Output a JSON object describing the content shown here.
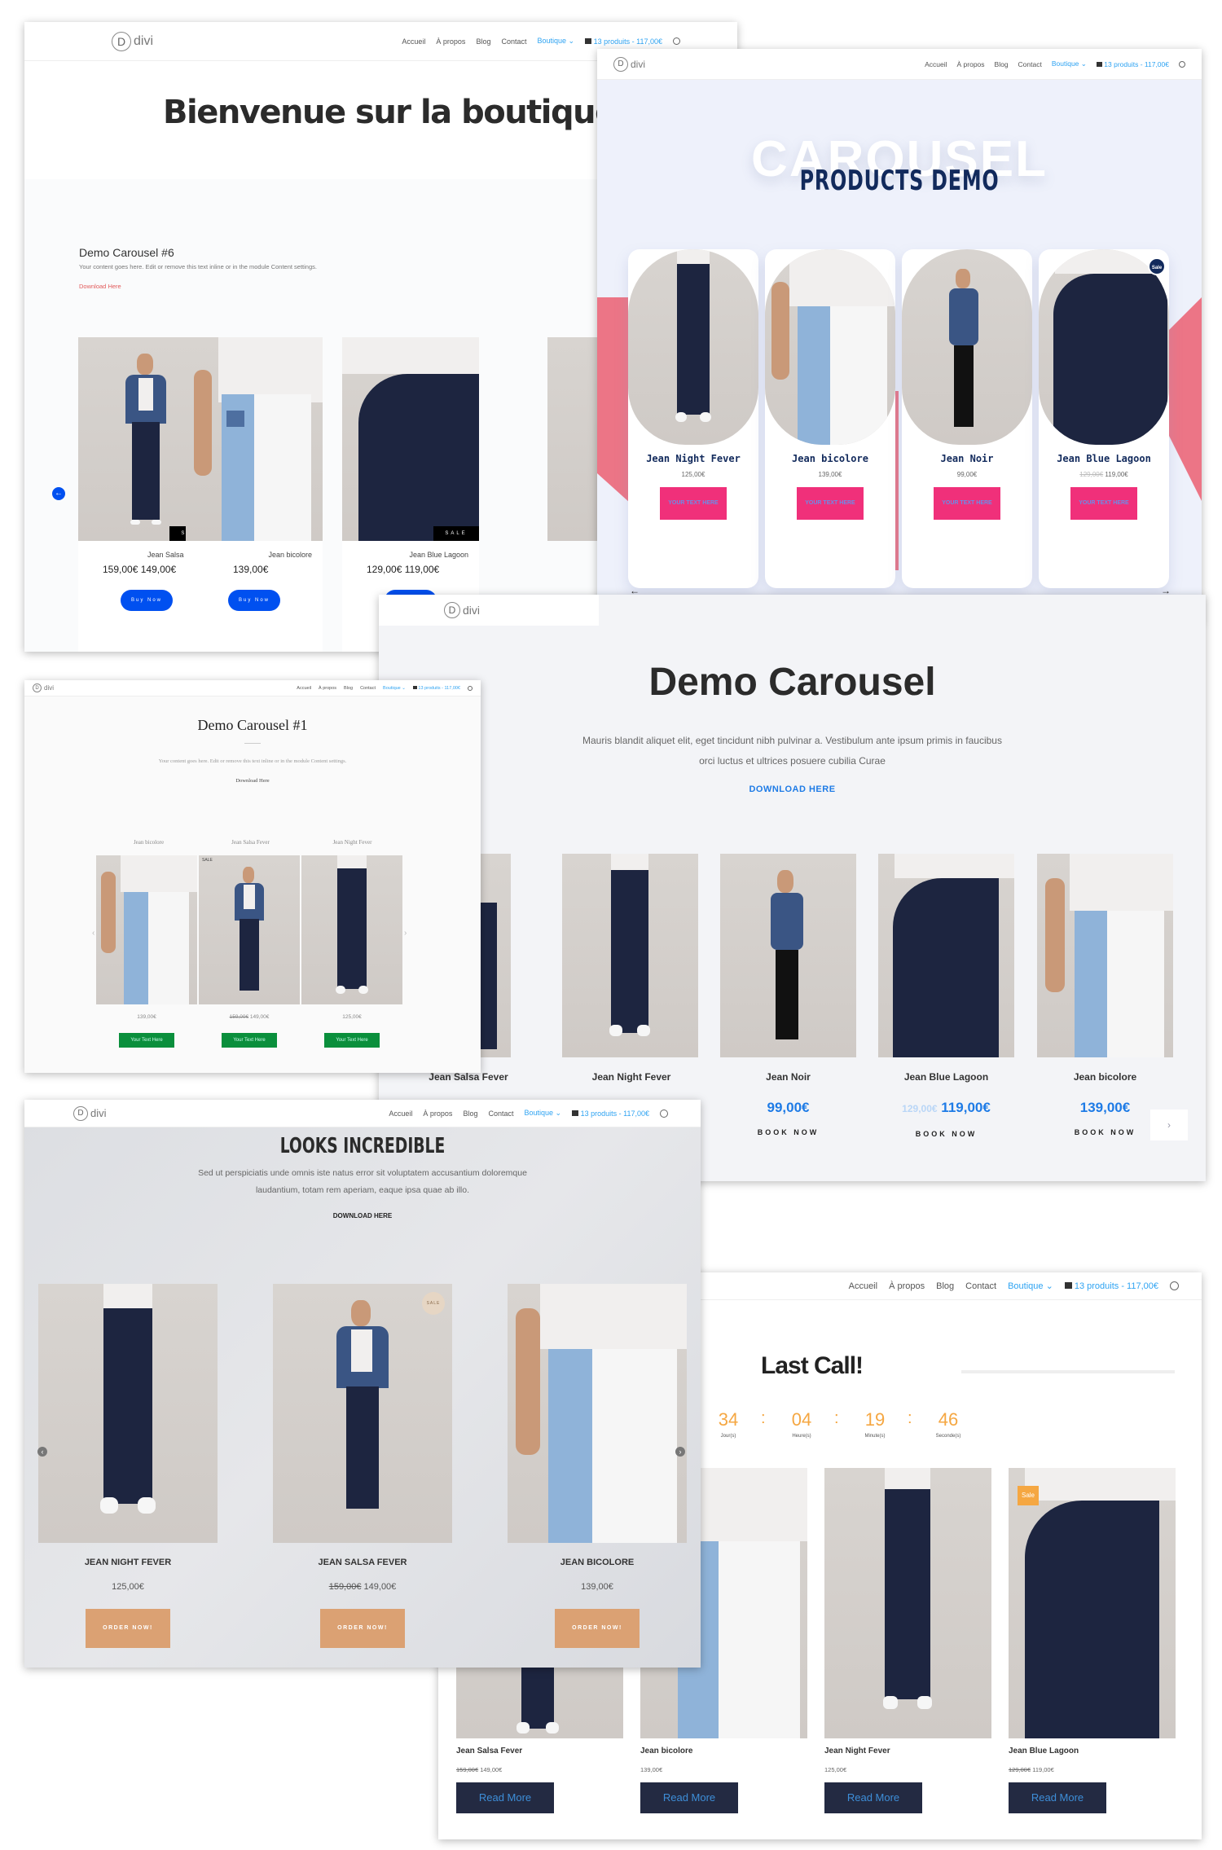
{
  "nav": {
    "logo": "divi",
    "logo_letter": "D",
    "items": [
      "Accueil",
      "À propos",
      "Blog",
      "Contact"
    ],
    "shop": "Boutique",
    "cart": "13 produits - 117,00€"
  },
  "panel1": {
    "title": "Bienvenue sur la boutique !",
    "module_title": "Demo Carousel #6",
    "module_text": "Your content goes here. Edit or remove this text inline or in the module Content settings.",
    "module_link": "Download Here",
    "sale_label": "SALE",
    "products": [
      {
        "name": "Jean Salsa Fever",
        "old_price": "159,00€",
        "price": "149,00€",
        "button": "Buy Now",
        "sale": true
      },
      {
        "name": "Jean bicolore",
        "old_price": "",
        "price": "139,00€",
        "button": "Buy Now",
        "sale": false
      },
      {
        "name": "Jean Blue Lagoon",
        "old_price": "129,00€",
        "price": "119,00€",
        "button": "Buy Now",
        "sale": true
      }
    ],
    "accent": "#0050f0"
  },
  "panel2": {
    "bg_title": "CAROUSEL",
    "title": "PRODUCTS DEMO",
    "sale_badge": "Sale",
    "products": [
      {
        "name": "Jean Night Fever",
        "old_price": "",
        "price": "125,00€",
        "button": "YOUR TEXT HERE"
      },
      {
        "name": "Jean bicolore",
        "old_price": "",
        "price": "139,00€",
        "button": "YOUR TEXT HERE"
      },
      {
        "name": "Jean Noir",
        "old_price": "",
        "price": "99,00€",
        "button": "YOUR TEXT HERE"
      },
      {
        "name": "Jean Blue Lagoon",
        "old_price": "129,00€",
        "price": "119,00€",
        "button": "YOUR TEXT HERE"
      }
    ],
    "prev_arrow": "←",
    "next_arrow": "→",
    "accent": "#f0307a"
  },
  "panel3": {
    "title": "Demo Carousel",
    "text": "Mauris blandit aliquet elit, eget tincidunt nibh pulvinar a. Vestibulum ante ipsum primis in faucibus orci luctus et ultrices posuere cubilia Curae",
    "link": "DOWNLOAD HERE",
    "products": [
      {
        "name": "Jean Salsa Fever",
        "old_price": "",
        "price": "",
        "button": ""
      },
      {
        "name": "Jean Night Fever",
        "old_price": "",
        "price": "",
        "button": ""
      },
      {
        "name": "Jean Noir",
        "old_price": "",
        "price": "99,00€",
        "button": "BOOK NOW"
      },
      {
        "name": "Jean Blue Lagoon",
        "old_price": "129,00€",
        "price": "119,00€",
        "button": "BOOK NOW"
      },
      {
        "name": "Jean bicolore",
        "old_price": "",
        "price": "139,00€",
        "button": "BOOK NOW"
      }
    ],
    "next_arrow": "›",
    "accent": "#1e7be6"
  },
  "panel4": {
    "title": "Demo Carousel #1",
    "text": "Your content goes here. Edit or remove this text inline or in the module Content settings.",
    "link": "Download Here",
    "sale_label": "SALE",
    "products": [
      {
        "name": "Jean bicolore",
        "old_price": "",
        "price": "139,00€",
        "button": "Your Text Here"
      },
      {
        "name": "Jean Salsa Fever",
        "old_price": "159,00€",
        "price": "149,00€",
        "button": "Your Text Here"
      },
      {
        "name": "Jean Night Fever",
        "old_price": "",
        "price": "125,00€",
        "button": "Your Text Here"
      }
    ],
    "prev_arrow": "‹",
    "next_arrow": "›",
    "accent": "#0a8f3c"
  },
  "panel5": {
    "title": "LOOKS INCREDIBLE",
    "text": "Sed ut perspiciatis unde omnis iste natus error sit voluptatem accusantium doloremque laudantium, totam rem aperiam, eaque ipsa quae ab illo.",
    "link": "DOWNLOAD HERE",
    "sale_label": "SALE",
    "products": [
      {
        "name": "JEAN NIGHT FEVER",
        "old_price": "",
        "price": "125,00€",
        "button": "ORDER NOW!"
      },
      {
        "name": "JEAN SALSA FEVER",
        "old_price": "159,00€",
        "price": "149,00€",
        "button": "ORDER NOW!"
      },
      {
        "name": "JEAN BICOLORE",
        "old_price": "",
        "price": "139,00€",
        "button": "ORDER NOW!"
      }
    ],
    "prev_arrow": "‹",
    "next_arrow": "›",
    "accent": "#dba173"
  },
  "panel6": {
    "title": "Last Call!",
    "countdown": [
      {
        "value": "34",
        "label": "Jour(s)"
      },
      {
        "value": "04",
        "label": "Heure(s)"
      },
      {
        "value": "19",
        "label": "Minute(s)"
      },
      {
        "value": "46",
        "label": "Seconde(s)"
      }
    ],
    "separator": ":",
    "sale_badge": "Sale",
    "products": [
      {
        "name": "Jean Salsa Fever",
        "old_price": "159,00€",
        "price": "149,00€",
        "button": "Read More"
      },
      {
        "name": "Jean bicolore",
        "old_price": "",
        "price": "139,00€",
        "button": "Read More"
      },
      {
        "name": "Jean Night Fever",
        "old_price": "",
        "price": "125,00€",
        "button": "Read More"
      },
      {
        "name": "Jean Blue Lagoon",
        "old_price": "129,00€",
        "price": "119,00€",
        "button": "Read More"
      }
    ],
    "accent": "#f5a742"
  }
}
